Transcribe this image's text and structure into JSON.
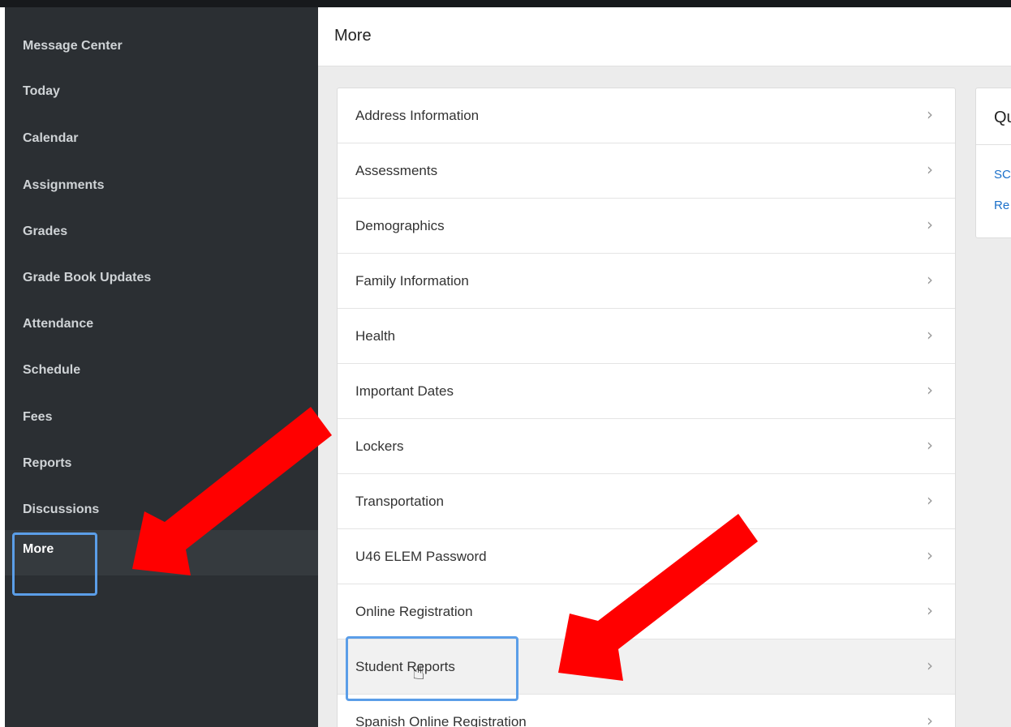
{
  "sidebar": {
    "items": [
      {
        "label": "Message Center"
      },
      {
        "label": "Today"
      },
      {
        "label": "Calendar"
      },
      {
        "label": "Assignments"
      },
      {
        "label": "Grades"
      },
      {
        "label": "Grade Book Updates"
      },
      {
        "label": "Attendance"
      },
      {
        "label": "Schedule"
      },
      {
        "label": "Fees"
      },
      {
        "label": "Reports"
      },
      {
        "label": "Discussions"
      },
      {
        "label": "More"
      }
    ],
    "active": "More"
  },
  "header": {
    "title": "More"
  },
  "list": {
    "items": [
      {
        "label": "Address Information"
      },
      {
        "label": "Assessments"
      },
      {
        "label": "Demographics"
      },
      {
        "label": "Family Information"
      },
      {
        "label": "Health"
      },
      {
        "label": "Important Dates"
      },
      {
        "label": "Lockers"
      },
      {
        "label": "Transportation"
      },
      {
        "label": "U46 ELEM Password"
      },
      {
        "label": "Online Registration"
      },
      {
        "label": "Student Reports"
      },
      {
        "label": "Spanish Online Registration"
      }
    ],
    "chevron": "›",
    "hovered": "Student Reports"
  },
  "quick_links": {
    "title": "Qu",
    "links": [
      {
        "label": "SC"
      },
      {
        "label": "Re"
      }
    ]
  },
  "colors": {
    "sidebar_bg": "#2b2f33",
    "active_bg": "#353a3e",
    "highlight": "#5b9ee8",
    "arrow": "#ff0000",
    "link": "#1a6fc9"
  },
  "icons": {
    "chevron": "chevron-right-icon",
    "cursor": "hand-pointer-cursor-icon"
  }
}
